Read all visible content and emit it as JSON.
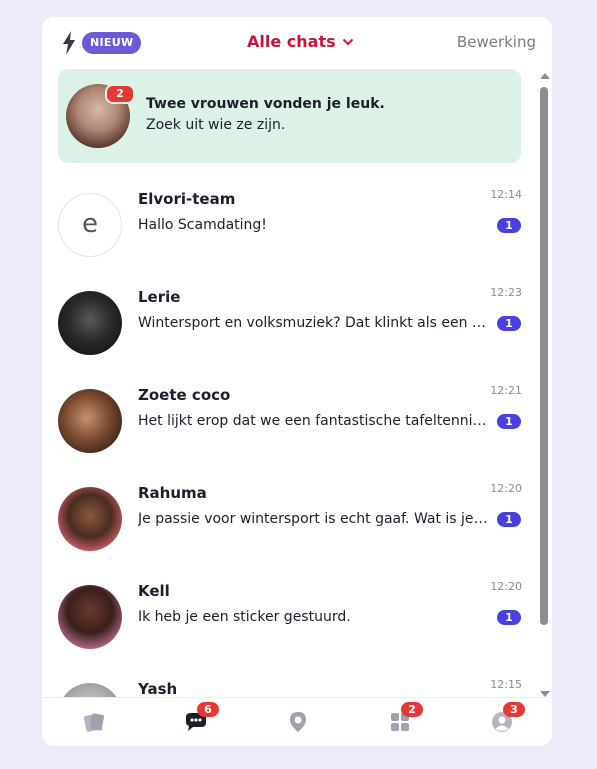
{
  "header": {
    "badge": "NIEUW",
    "title": "Alle chats",
    "edit": "Bewerking"
  },
  "promo": {
    "badge": "2",
    "title": "Twee vrouwen vonden je leuk.",
    "subtitle": "Zoek uit wie ze zijn."
  },
  "chats": [
    {
      "name": "Elvori-team",
      "message": "Hallo Scamdating!",
      "time": "12:14",
      "unread": "1",
      "avatar_letter": "e"
    },
    {
      "name": "Lerie",
      "message": "Wintersport en volksmuziek? Dat klinkt als een leuke combinatie!",
      "time": "12:23",
      "unread": "1"
    },
    {
      "name": "Zoete coco",
      "message": "Het lijkt erop dat we een fantastische tafeltennis match zijn!",
      "time": "12:21",
      "unread": "1"
    },
    {
      "name": "Rahuma",
      "message": "Je passie voor wintersport is echt gaaf. Wat is je favoriete plek?",
      "time": "12:20",
      "unread": "1"
    },
    {
      "name": "Kell",
      "message": "Ik heb je een sticker gestuurd.",
      "time": "12:20",
      "unread": "1"
    },
    {
      "name": "Yash",
      "message": "",
      "time": "12:15",
      "unread": ""
    }
  ],
  "tabbar": {
    "chats_badge": "6",
    "discover_badge": "2",
    "profile_badge": "3"
  },
  "colors": {
    "accent": "#c8143c",
    "unread": "#4a3fe0",
    "badge": "#e53935",
    "nieuw": "#6b5bd6",
    "promo_bg": "#dcf2e6"
  }
}
